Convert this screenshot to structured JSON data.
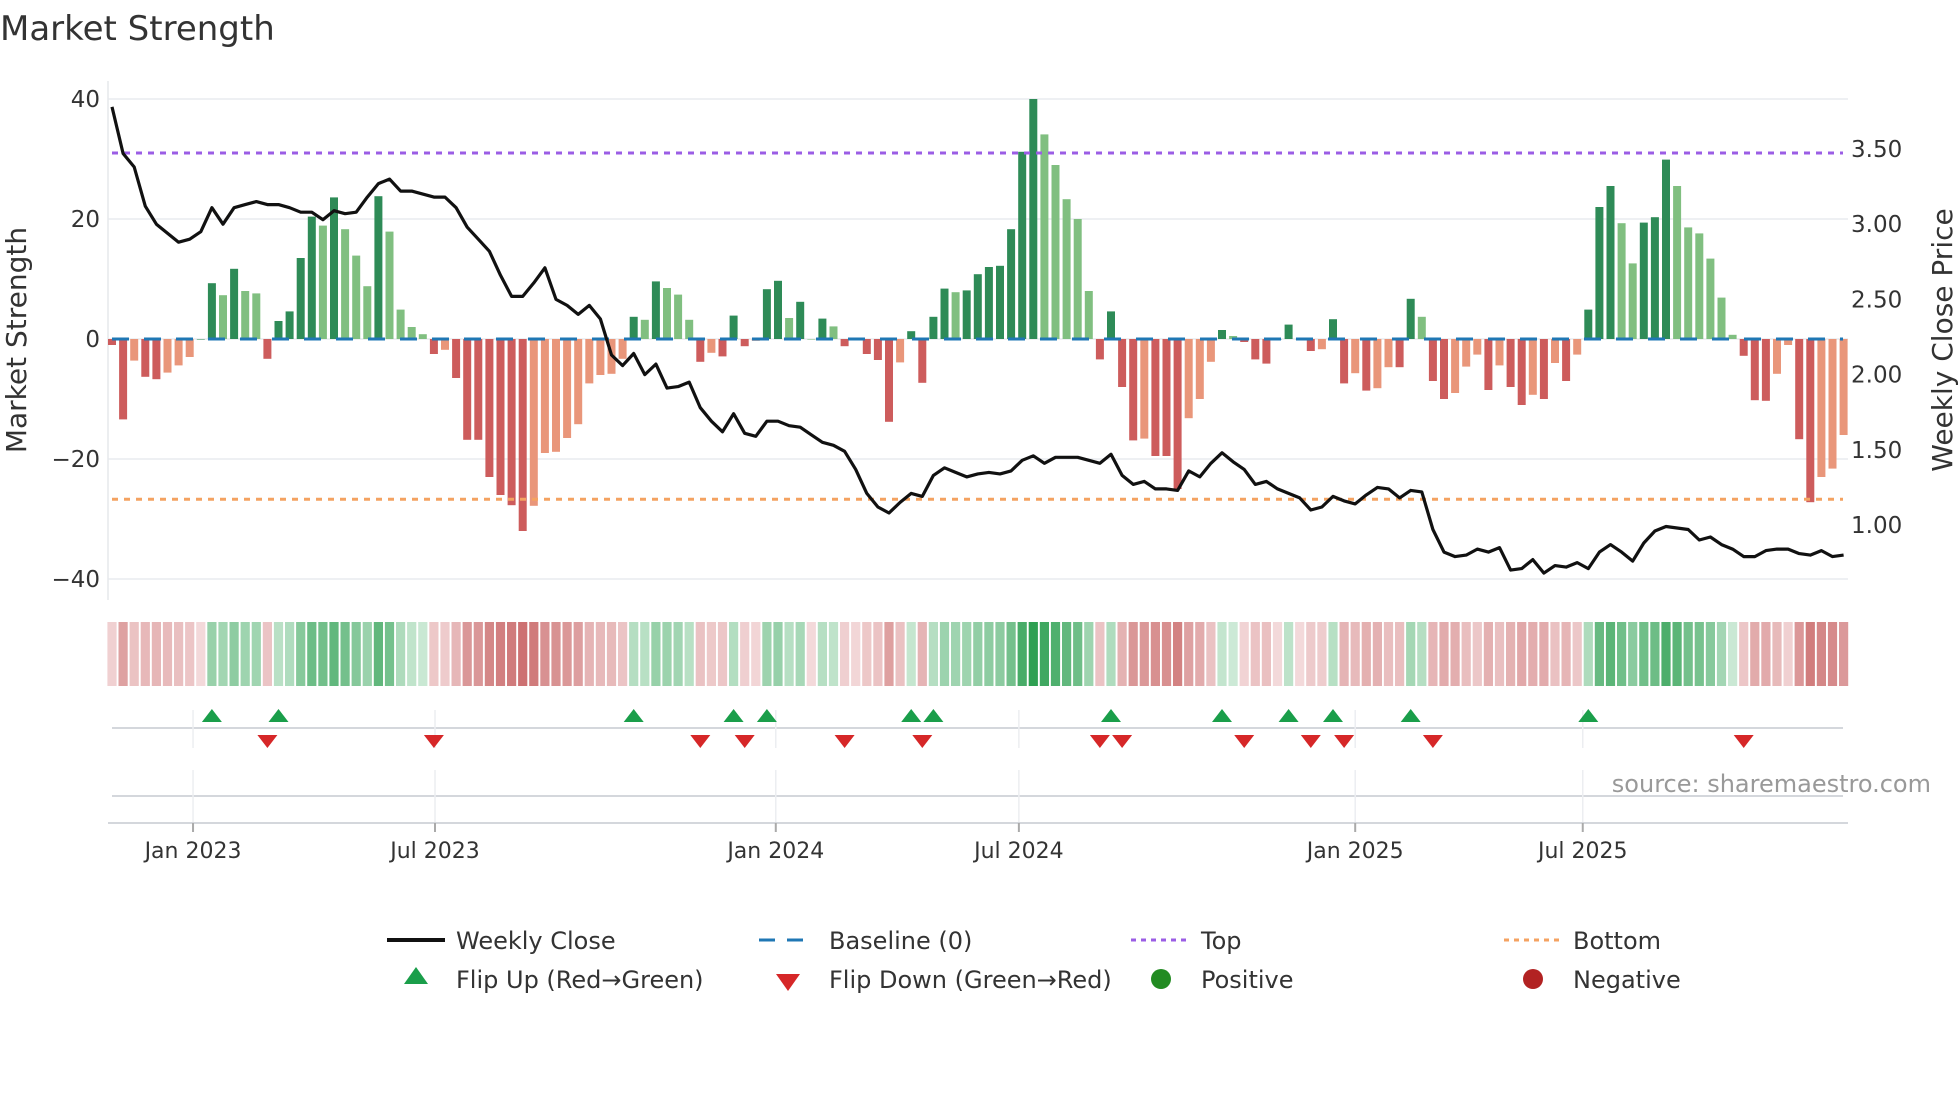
{
  "chart_data": {
    "type": "bar",
    "title": "Market Strength",
    "ylabel": "Market Strength",
    "y2label": "Weekly Close Price",
    "ylim": [
      -43.5,
      43
    ],
    "y2lim": [
      0.5,
      3.95
    ],
    "grid": true,
    "legend_position": "bottom",
    "left_ticks": [
      {
        "v": 40,
        "label": "40"
      },
      {
        "v": 20,
        "label": "20"
      },
      {
        "v": 0,
        "label": "0"
      },
      {
        "v": -20,
        "label": "−20"
      },
      {
        "v": -40,
        "label": "−40"
      }
    ],
    "right_ticks": [
      {
        "v": 1.0,
        "label": "1.00"
      },
      {
        "v": 1.5,
        "label": "1.50"
      },
      {
        "v": 2.0,
        "label": "2.00"
      },
      {
        "v": 2.5,
        "label": "2.50"
      },
      {
        "v": 3.0,
        "label": "3.00"
      },
      {
        "v": 3.5,
        "label": "3.50"
      }
    ],
    "x_ticks": [
      {
        "week": 7.3,
        "label": "Jan 2023"
      },
      {
        "week": 29.1,
        "label": "Jul 2023"
      },
      {
        "week": 59.8,
        "label": "Jan 2024"
      },
      {
        "week": 81.7,
        "label": "Jul 2024"
      },
      {
        "week": 112,
        "label": "Jan 2025"
      },
      {
        "week": 132.5,
        "label": "Jul 2025"
      }
    ],
    "top_level": 31,
    "bottom_level": -26.7,
    "baseline": 0,
    "strength": [
      -1,
      -13.4,
      -3.6,
      -6.3,
      -6.7,
      -5.6,
      -4.4,
      -3,
      0,
      9.3,
      7.3,
      11.7,
      8,
      7.6,
      -3.3,
      3,
      4.6,
      13.5,
      20.4,
      18.9,
      23.6,
      18.3,
      13.9,
      8.8,
      23.8,
      17.9,
      4.9,
      2,
      0.8,
      -2.5,
      -1.8,
      -6.5,
      -16.8,
      -16.8,
      -23,
      -26,
      -27.7,
      -32,
      -27.8,
      -19,
      -18.8,
      -16.5,
      -14.2,
      -7.4,
      -6,
      -5.8,
      -3.3,
      3.7,
      3.2,
      9.6,
      8.5,
      7.4,
      3.2,
      -3.8,
      -2.3,
      -2.9,
      3.9,
      -1.2,
      -0.3,
      8.3,
      9.7,
      3.5,
      6.2,
      0,
      3.4,
      2.1,
      -1.2,
      -0.2,
      -2.5,
      -3.5,
      -13.8,
      -3.9,
      1.3,
      -7.3,
      3.7,
      8.4,
      7.8,
      8.1,
      10.8,
      12.0,
      12.2,
      18.3,
      31.2,
      40,
      34.1,
      29,
      23.3,
      20,
      8,
      -3.4,
      4.6,
      -8,
      -16.9,
      -16.6,
      -19.5,
      -19.5,
      -25,
      -13.2,
      -10,
      -3.8,
      1.5,
      0.5,
      -0.5,
      -3.4,
      -4.1,
      0,
      2.4,
      0,
      -2,
      -1.7,
      3.3,
      -7.4,
      -5.7,
      -8.6,
      -8.2,
      -4.7,
      -4.7,
      6.7,
      3.7,
      -7,
      -10,
      -9,
      -4.6,
      -2.6,
      -8.5,
      -4.4,
      -8,
      -11,
      -9.3,
      -10,
      -4,
      -7,
      -2.6,
      4.9,
      22,
      25.5,
      19.3,
      12.6,
      19.4,
      20.3,
      29.9,
      25.5,
      18.6,
      17.6,
      13.4,
      6.9,
      0.7,
      -2.8,
      -10.2,
      -10.3,
      -5.8,
      -1,
      -16.7,
      -27.2,
      -23,
      -21.6,
      -16
    ],
    "weekly_close": [
      3.78,
      3.47,
      3.38,
      3.12,
      3.0,
      2.94,
      2.88,
      2.9,
      2.95,
      3.11,
      3.0,
      3.11,
      3.13,
      3.15,
      3.13,
      3.13,
      3.11,
      3.08,
      3.08,
      3.03,
      3.09,
      3.07,
      3.08,
      3.18,
      3.27,
      3.3,
      3.22,
      3.22,
      3.2,
      3.18,
      3.18,
      3.11,
      2.98,
      2.9,
      2.82,
      2.66,
      2.52,
      2.52,
      2.61,
      2.71,
      2.5,
      2.46,
      2.4,
      2.46,
      2.37,
      2.13,
      2.06,
      2.14,
      2.0,
      2.07,
      1.91,
      1.92,
      1.95,
      1.78,
      1.69,
      1.62,
      1.74,
      1.61,
      1.59,
      1.69,
      1.69,
      1.66,
      1.65,
      1.6,
      1.55,
      1.53,
      1.49,
      1.37,
      1.21,
      1.12,
      1.08,
      1.15,
      1.21,
      1.19,
      1.33,
      1.38,
      1.35,
      1.32,
      1.34,
      1.35,
      1.34,
      1.36,
      1.43,
      1.46,
      1.41,
      1.45,
      1.45,
      1.45,
      1.43,
      1.41,
      1.47,
      1.33,
      1.27,
      1.29,
      1.24,
      1.24,
      1.23,
      1.36,
      1.32,
      1.41,
      1.48,
      1.42,
      1.37,
      1.27,
      1.29,
      1.24,
      1.21,
      1.18,
      1.1,
      1.12,
      1.19,
      1.16,
      1.14,
      1.2,
      1.25,
      1.24,
      1.18,
      1.23,
      1.22,
      0.97,
      0.82,
      0.79,
      0.8,
      0.84,
      0.82,
      0.85,
      0.7,
      0.71,
      0.77,
      0.68,
      0.73,
      0.72,
      0.75,
      0.71,
      0.82,
      0.87,
      0.82,
      0.76,
      0.88,
      0.96,
      0.99,
      0.98,
      0.97,
      0.9,
      0.92,
      0.87,
      0.84,
      0.79,
      0.79,
      0.83,
      0.84,
      0.84,
      0.81,
      0.8,
      0.83,
      0.79,
      0.8
    ],
    "flip_up_weeks": [
      9,
      15,
      47,
      56,
      59,
      72,
      74,
      90,
      100,
      106,
      110,
      117,
      133
    ],
    "flip_down_weeks": [
      14,
      29,
      53,
      57,
      66,
      73,
      89,
      91,
      102,
      108,
      111,
      119,
      147
    ],
    "legend": {
      "weekly_close": "Weekly Close",
      "baseline": "Baseline (0)",
      "top": "Top",
      "bottom": "Bottom",
      "flip_up": "Flip Up (Red→Green)",
      "flip_down": "Flip Down (Green→Red)",
      "positive": "Positive",
      "negative": "Negative"
    },
    "colors": {
      "pos_rising": "#2e8b57",
      "pos_falling": "#80bf80",
      "neg_falling": "#cd5c5c",
      "neg_rising": "#e9967a",
      "line": "#111111",
      "baseline": "#1f77b4",
      "top": "#9b5de5",
      "bottom": "#f4a261",
      "flip_up": "#1a9e4a",
      "flip_down": "#d62728",
      "positive": "#228b22",
      "negative": "#b22222"
    }
  },
  "source": "source: sharemaestro.com"
}
